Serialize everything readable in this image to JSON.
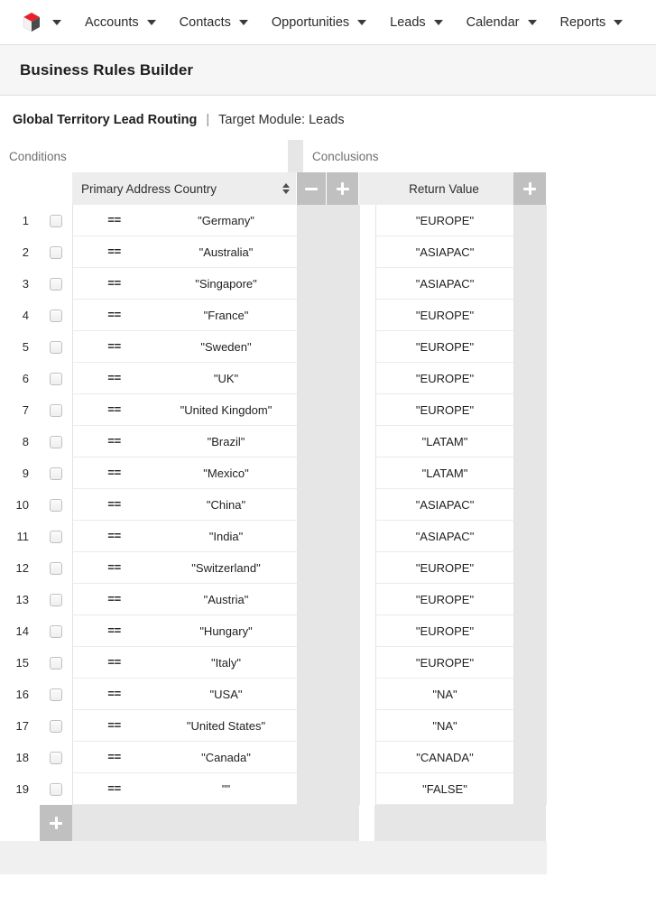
{
  "topnav": {
    "logo_name": "app-logo-cube",
    "logo_colors": {
      "top": "#e8202a",
      "left": "#f2f2f2",
      "right": "#4a4a4a"
    },
    "items": [
      {
        "label": "Accounts",
        "icon": "chevron-down-icon"
      },
      {
        "label": "Contacts",
        "icon": "chevron-down-icon"
      },
      {
        "label": "Opportunities",
        "icon": "chevron-down-icon"
      },
      {
        "label": "Leads",
        "icon": "chevron-down-icon"
      },
      {
        "label": "Calendar",
        "icon": "chevron-down-icon"
      },
      {
        "label": "Reports",
        "icon": "chevron-down-icon"
      }
    ]
  },
  "page": {
    "title": "Business Rules Builder"
  },
  "rule": {
    "name": "Global Territory Lead Routing",
    "separator": "|",
    "target_module": "Target Module: Leads"
  },
  "builder": {
    "captions": {
      "conditions": "Conditions",
      "conclusions": "Conclusions"
    },
    "headers": {
      "condition_field": "Primary Address Country",
      "return_value": "Return Value",
      "sort_icon": "sort-arrows-icon",
      "remove_condition_icon": "minus-icon",
      "add_condition_icon": "plus-icon",
      "add_conclusion_icon": "plus-icon"
    },
    "footer": {
      "add_row_icon": "plus-icon"
    },
    "rows": [
      {
        "num": "1",
        "op": "==",
        "value": "\"Germany\"",
        "ret": "\"EUROPE\""
      },
      {
        "num": "2",
        "op": "==",
        "value": "\"Australia\"",
        "ret": "\"ASIAPAC\""
      },
      {
        "num": "3",
        "op": "==",
        "value": "\"Singapore\"",
        "ret": "\"ASIAPAC\""
      },
      {
        "num": "4",
        "op": "==",
        "value": "\"France\"",
        "ret": "\"EUROPE\""
      },
      {
        "num": "5",
        "op": "==",
        "value": "\"Sweden\"",
        "ret": "\"EUROPE\""
      },
      {
        "num": "6",
        "op": "==",
        "value": "\"UK\"",
        "ret": "\"EUROPE\""
      },
      {
        "num": "7",
        "op": "==",
        "value": "\"United Kingdom\"",
        "ret": "\"EUROPE\""
      },
      {
        "num": "8",
        "op": "==",
        "value": "\"Brazil\"",
        "ret": "\"LATAM\""
      },
      {
        "num": "9",
        "op": "==",
        "value": "\"Mexico\"",
        "ret": "\"LATAM\""
      },
      {
        "num": "10",
        "op": "==",
        "value": "\"China\"",
        "ret": "\"ASIAPAC\""
      },
      {
        "num": "11",
        "op": "==",
        "value": "\"India\"",
        "ret": "\"ASIAPAC\""
      },
      {
        "num": "12",
        "op": "==",
        "value": "\"Switzerland\"",
        "ret": "\"EUROPE\""
      },
      {
        "num": "13",
        "op": "==",
        "value": "\"Austria\"",
        "ret": "\"EUROPE\""
      },
      {
        "num": "14",
        "op": "==",
        "value": "\"Hungary\"",
        "ret": "\"EUROPE\""
      },
      {
        "num": "15",
        "op": "==",
        "value": "\"Italy\"",
        "ret": "\"EUROPE\""
      },
      {
        "num": "16",
        "op": "==",
        "value": "\"USA\"",
        "ret": "\"NA\""
      },
      {
        "num": "17",
        "op": "==",
        "value": "\"United States\"",
        "ret": "\"NA\""
      },
      {
        "num": "18",
        "op": "==",
        "value": "\"Canada\"",
        "ret": "\"CANADA\""
      },
      {
        "num": "19",
        "op": "==",
        "value": "\"\"",
        "ret": "\"FALSE\""
      }
    ]
  }
}
